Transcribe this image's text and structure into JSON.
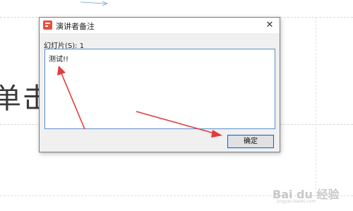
{
  "slide": {
    "visible_text": "单击"
  },
  "dialog": {
    "title": "演讲者备注",
    "close_symbol": "✕",
    "slide_label": "幻灯片(S): 1",
    "notes_value": "测试!!",
    "ok_label": "确定"
  },
  "watermark": {
    "logo": "Bai du 经验",
    "url": "jingyan.baidu.com"
  },
  "colors": {
    "annotation_arrow": "#e03c3c",
    "accent_border": "#0a64c8",
    "app_icon": "#e5503c"
  },
  "icons": [
    "presentation-app-icon",
    "close-icon"
  ]
}
